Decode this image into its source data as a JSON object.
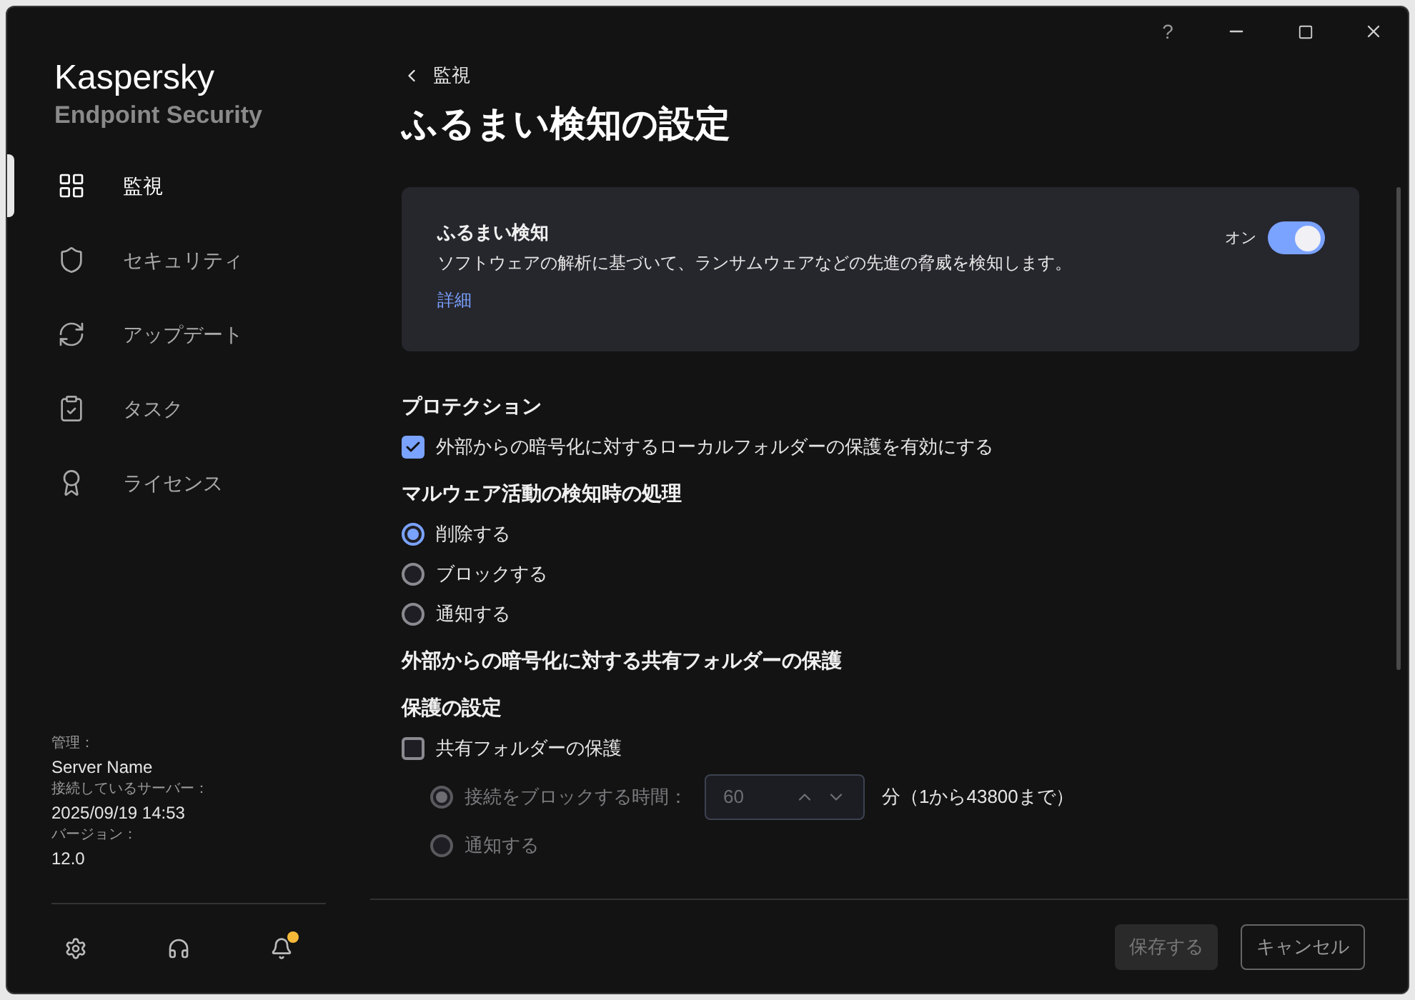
{
  "window": {
    "help": "?"
  },
  "sidebar": {
    "brand": "Kaspersky",
    "product": "Endpoint Security",
    "items": [
      {
        "label": "監視",
        "selected": true
      },
      {
        "label": "セキュリティ",
        "selected": false
      },
      {
        "label": "アップデート",
        "selected": false
      },
      {
        "label": "タスク",
        "selected": false
      },
      {
        "label": "ライセンス",
        "selected": false
      }
    ],
    "info": [
      {
        "label": "管理：",
        "value": "Server Name"
      },
      {
        "label": "接続しているサーバー：",
        "value": "2025/09/19 14:53"
      },
      {
        "label": "バージョン：",
        "value": "12.0"
      }
    ],
    "notification_dot": true
  },
  "main": {
    "back": "監視",
    "title": "ふるまい検知の設定",
    "card": {
      "title": "ふるまい検知",
      "description": "ソフトウェアの解析に基づいて、ランサムウェアなどの先進の脅威を検知します。",
      "link": "詳細",
      "toggle_label": "オン",
      "on": true
    },
    "content": [
      {
        "kind": "heading",
        "label": "プロテクション"
      },
      {
        "kind": "checkbox",
        "label": "外部からの暗号化に対するローカルフォルダーの保護を有効にする",
        "checked": true
      },
      {
        "kind": "heading",
        "label": "マルウェア活動の検知時の処理"
      },
      {
        "kind": "radio",
        "label": "削除する",
        "selected": true,
        "disabled": false
      },
      {
        "kind": "radio",
        "label": "ブロックする",
        "selected": false,
        "disabled": false
      },
      {
        "kind": "radio",
        "label": "通知する",
        "selected": false,
        "disabled": false
      },
      {
        "kind": "heading",
        "label": "外部からの暗号化に対する共有フォルダーの保護"
      },
      {
        "kind": "heading",
        "label": "保護の設定"
      },
      {
        "kind": "checkbox",
        "label": "共有フォルダーの保護",
        "checked": false,
        "children": [
          {
            "kind": "spinner",
            "label": "接続をブロックする時間：",
            "selected": true,
            "disabled": true,
            "value": "60",
            "unit": "分（1から43800まで）"
          },
          {
            "kind": "radio",
            "label": "通知する",
            "selected": false,
            "disabled": true
          }
        ]
      }
    ]
  },
  "footer": {
    "buttons": [
      {
        "label": "保存する",
        "disabled": true
      },
      {
        "label": "キャンセル",
        "disabled": false
      }
    ]
  }
}
